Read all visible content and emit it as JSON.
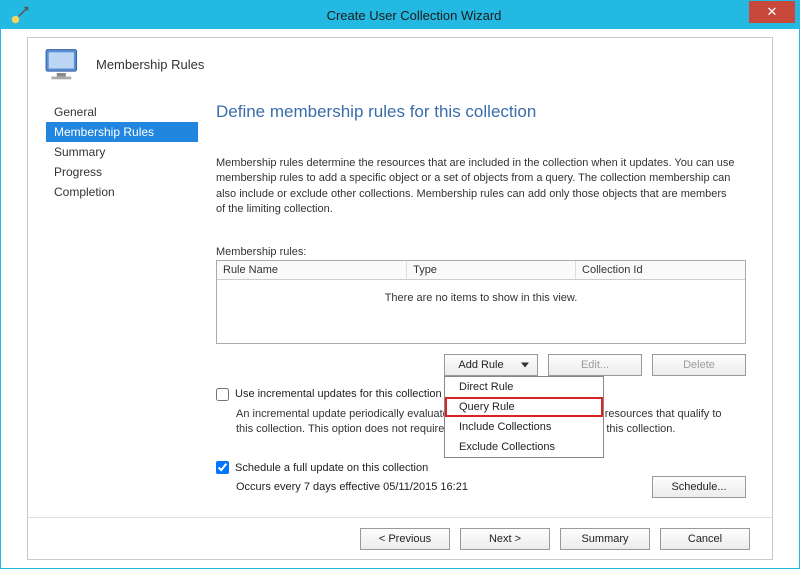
{
  "window": {
    "title": "Create User Collection Wizard"
  },
  "header": {
    "label": "Membership Rules"
  },
  "sidebar": {
    "items": [
      {
        "label": "General"
      },
      {
        "label": "Membership Rules"
      },
      {
        "label": "Summary"
      },
      {
        "label": "Progress"
      },
      {
        "label": "Completion"
      }
    ],
    "active_index": 1
  },
  "page": {
    "title": "Define membership rules for this collection",
    "description": "Membership rules determine the resources that are included in the collection when it updates. You can use membership rules to add a specific object or a set of objects from a query. The collection membership can also include or exclude other collections. Membership rules can add only those objects that are members of the limiting collection.",
    "rules_label": "Membership rules:",
    "columns": {
      "c1": "Rule Name",
      "c2": "Type",
      "c3": "Collection Id"
    },
    "empty_message": "There are no items to show in this view.",
    "buttons": {
      "add_rule": "Add Rule",
      "edit": "Edit...",
      "delete": "Delete"
    },
    "add_rule_menu": {
      "direct": "Direct Rule",
      "query": "Query Rule",
      "include": "Include Collections",
      "exclude": "Exclude Collections"
    },
    "incremental": {
      "checked": false,
      "label": "Use incremental updates for this collection",
      "description": "An incremental update periodically evaluates new resources and then adds resources that qualify to this collection. This option does not require you to schedule a full update for this collection."
    },
    "full_update": {
      "checked": true,
      "label": "Schedule a full update on this collection",
      "occurs": "Occurs every 7 days effective 05/11/2015 16:21",
      "schedule_button": "Schedule..."
    }
  },
  "footer": {
    "previous": "< Previous",
    "next": "Next >",
    "summary": "Summary",
    "cancel": "Cancel"
  }
}
